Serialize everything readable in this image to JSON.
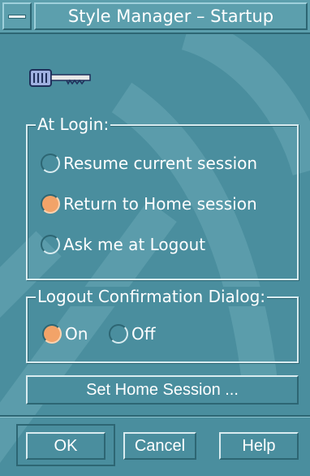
{
  "window": {
    "title": "Style Manager – Startup"
  },
  "icons": {
    "window_menu": "window-menu-icon",
    "key": "key-icon"
  },
  "colors": {
    "background": "#4a8e9e",
    "title_bar": "#5c9fad",
    "radio_selected": "#f2a368",
    "text": "#ffffff"
  },
  "at_login": {
    "legend": "At Login:",
    "options": [
      {
        "label": "Resume current session",
        "selected": false
      },
      {
        "label": "Return to Home session",
        "selected": true
      },
      {
        "label": "Ask me at Logout",
        "selected": false
      }
    ]
  },
  "logout_confirmation": {
    "legend": "Logout Confirmation Dialog:",
    "options": [
      {
        "label": "On",
        "selected": true
      },
      {
        "label": "Off",
        "selected": false
      }
    ]
  },
  "buttons": {
    "set_home_session": "Set Home Session ...",
    "ok": "OK",
    "cancel": "Cancel",
    "help": "Help"
  }
}
